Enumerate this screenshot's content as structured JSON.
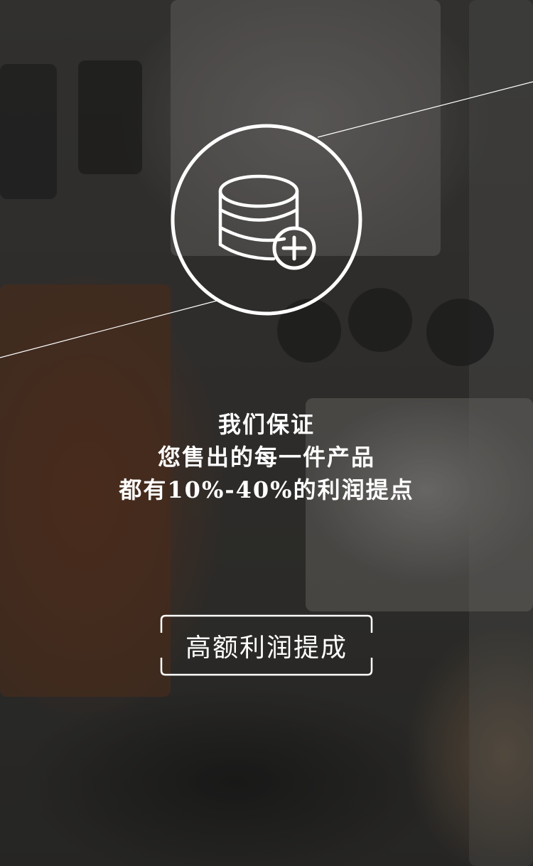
{
  "colors": {
    "text": "#ffffff",
    "outline": "#ffffff",
    "background": "#2b2b29"
  },
  "icon": {
    "name": "database-add-icon"
  },
  "headline": {
    "line1": "我们保证",
    "line2": "您售出的每一件产品",
    "line3": "都有10%-40%的利润提点"
  },
  "cta": {
    "label": "高额利润提成"
  }
}
